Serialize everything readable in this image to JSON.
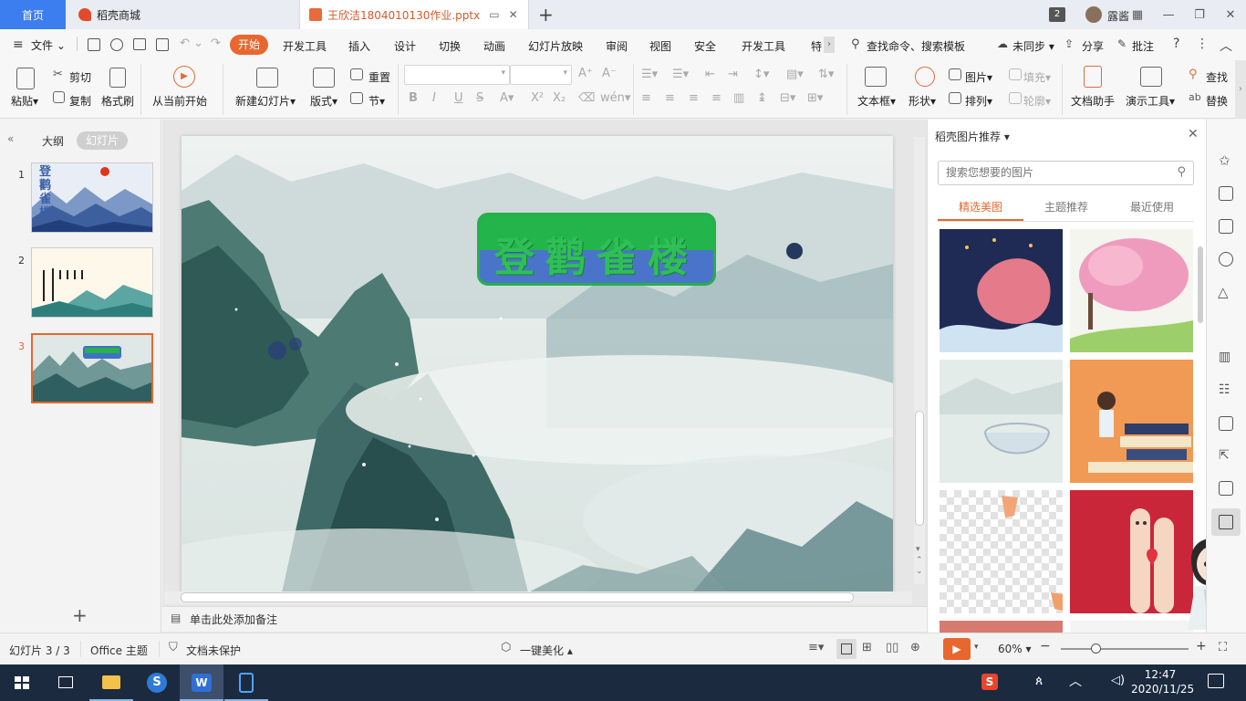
{
  "titlebar": {
    "home_tab": "首页",
    "store_tab": "稻壳商城",
    "doc_tab": "王欣洁1804010130作业.pptx",
    "badge": "2",
    "user_name": "露酱"
  },
  "menubar": {
    "file": "文件",
    "items": [
      "开始",
      "开发工具",
      "插入",
      "设计",
      "切换",
      "动画",
      "幻灯片放映",
      "审阅",
      "视图",
      "安全",
      "开发工具",
      "特"
    ],
    "search": "查找命令、搜索模板",
    "sync": "未同步",
    "share": "分享",
    "comment": "批注"
  },
  "ribbon": {
    "paste": "粘贴",
    "cut": "剪切",
    "copy": "复制",
    "format_painter": "格式刷",
    "from_current": "从当前开始",
    "new_slide": "新建幻灯片",
    "layout": "版式",
    "reset": "重置",
    "section": "节",
    "textbox": "文本框",
    "shape": "形状",
    "picture": "图片",
    "fill": "填充",
    "arrange": "排列",
    "outline": "轮廓",
    "doc_assistant": "文档助手",
    "present_tools": "演示工具",
    "find": "查找",
    "replace": "替换"
  },
  "left_panel": {
    "outline_tab": "大纲",
    "slides_tab": "幻灯片",
    "thumbs": [
      "1",
      "2",
      "3"
    ],
    "thumb1_title": "登鹳雀楼"
  },
  "slide": {
    "title": "登鹳雀楼"
  },
  "notes": {
    "placeholder": "单击此处添加备注"
  },
  "right_panel": {
    "title": "稻壳图片推荐",
    "search_placeholder": "搜索您想要的图片",
    "tabs": [
      "精选美图",
      "主题推荐",
      "最近使用"
    ]
  },
  "statusbar": {
    "slide_info": "幻灯片 3 / 3",
    "theme": "Office 主题",
    "protect": "文档未保护",
    "beautify": "一键美化",
    "zoom": "60%"
  },
  "taskbar": {
    "time": "12:47",
    "date": "2020/11/25"
  },
  "colors": {
    "accent": "#e8672e",
    "home_tab": "#3c7df0",
    "title_green": "#23b54b",
    "title_blue": "#4a74c9"
  }
}
